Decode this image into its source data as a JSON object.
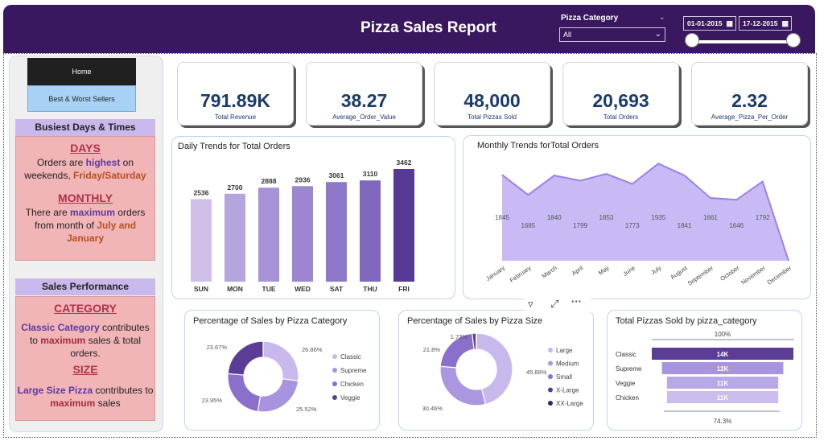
{
  "header": {
    "title": "Pizza Sales Report",
    "category_label": "Pizza Category",
    "category_value": "All",
    "start_date": "01-01-2015",
    "end_date": "17-12-2015",
    "slider_start": 0,
    "slider_end": 1
  },
  "nav": {
    "home": "Home",
    "best_worst": "Best & Worst Sellers"
  },
  "busiest": {
    "title": "Busiest Days & Times",
    "days_head": "DAYS",
    "days_t1": "Orders are ",
    "days_t2": "highest",
    "days_t3": " on weekends, ",
    "days_t4": "Friday/Saturday",
    "monthly_head": "MONTHLY",
    "monthly_t1": "There are ",
    "monthly_t2": "maximum",
    "monthly_t3": " orders from month of ",
    "monthly_t4": "July and January"
  },
  "sales_perf": {
    "title": "Sales Performance",
    "category_head": "CATEGORY",
    "cat_t1": "Classic Category",
    "cat_t2": " contributes to ",
    "cat_t3": "maximum",
    "cat_t4": " sales & total orders.",
    "size_head": "SIZE",
    "size_t1": "Large Size Pizza",
    "size_t2": " contributes to ",
    "size_t3": "maximum",
    "size_t4": " sales"
  },
  "kpis": [
    {
      "value": "791.89K",
      "label": "Total Revenue"
    },
    {
      "value": "38.27",
      "label": "Average_Order_Value"
    },
    {
      "value": "48,000",
      "label": "Total Pizzas Sold"
    },
    {
      "value": "20,693",
      "label": "Total Orders"
    },
    {
      "value": "2.32",
      "label": "Average_Pizza_Per_Order"
    }
  ],
  "visual_toolbar": {
    "filter_icon": "filter-icon",
    "focus_icon": "focus-mode-icon",
    "more_icon": "more-options-icon"
  },
  "colors": {
    "header": "#3a1860",
    "bar_light": "#cdbfe8",
    "bar_dark": "#563a94",
    "area": "#c9baf5",
    "area_line": "#9b80e6"
  },
  "chart_data": [
    {
      "type": "bar",
      "title": "Daily Trends for Total Orders",
      "categories": [
        "SUN",
        "MON",
        "TUE",
        "WED",
        "SAT",
        "THU",
        "FRI"
      ],
      "values": [
        2536,
        2700,
        2888,
        2936,
        3061,
        3110,
        3462
      ],
      "data_labels": [
        "2536",
        "2700",
        "2888",
        "2936",
        "3061",
        "3110",
        "3462"
      ],
      "colors": [
        "#cdbfe8",
        "#b6a4dc",
        "#a892d6",
        "#9d86d0",
        "#8e78c8",
        "#8068bd",
        "#563a94"
      ]
    },
    {
      "type": "area",
      "title": "Monthly Trends forTotal Orders",
      "categories": [
        "January",
        "February",
        "March",
        "April",
        "May",
        "June",
        "July",
        "August",
        "September",
        "October",
        "November",
        "December"
      ],
      "values": [
        1845,
        1685,
        1840,
        1799,
        1853,
        1773,
        1935,
        1841,
        1661,
        1646,
        1792,
        0
      ],
      "data_labels": [
        "1845",
        "1685",
        "1840",
        "1799",
        "1853",
        "1773",
        "1935",
        "1841",
        "1661",
        "1646",
        "1792",
        ""
      ]
    },
    {
      "type": "pie",
      "title": "Percentage of Sales by Pizza Category",
      "labels": [
        "Classic",
        "Supreme",
        "Chicken",
        "Veggie"
      ],
      "values": [
        26.86,
        25.52,
        23.95,
        23.67
      ],
      "data_labels": [
        "26.86%",
        "25.52%",
        "23.95%",
        "23.67%"
      ],
      "colors": [
        "#c9b8ec",
        "#a893de",
        "#8a6fcb",
        "#5b3d96"
      ]
    },
    {
      "type": "pie",
      "title": "Percentage of Sales by Pizza Size",
      "labels": [
        "Large",
        "Medium",
        "Small",
        "X-Large",
        "XX-Large"
      ],
      "values": [
        45.88,
        30.46,
        21.8,
        1.73,
        0.12
      ],
      "data_labels": [
        "45.88%",
        "30.46%",
        "21.8%",
        "1.73%",
        ""
      ],
      "colors": [
        "#c9b8ec",
        "#ab96e0",
        "#8a6fcb",
        "#5b3d96",
        "#3a1e6a"
      ]
    },
    {
      "type": "bar",
      "title": "Total Pizzas Sold by pizza_category",
      "categories": [
        "Classic",
        "Supreme",
        "Veggie",
        "Chicken"
      ],
      "values": [
        14,
        12,
        11,
        11
      ],
      "data_labels": [
        "14K",
        "12K",
        "11K",
        "11K"
      ],
      "top_label": "100%",
      "bottom_label": "74.3%",
      "colors": [
        "#5b3d96",
        "#a893de",
        "#b9a8e6",
        "#cbbdec"
      ]
    }
  ]
}
